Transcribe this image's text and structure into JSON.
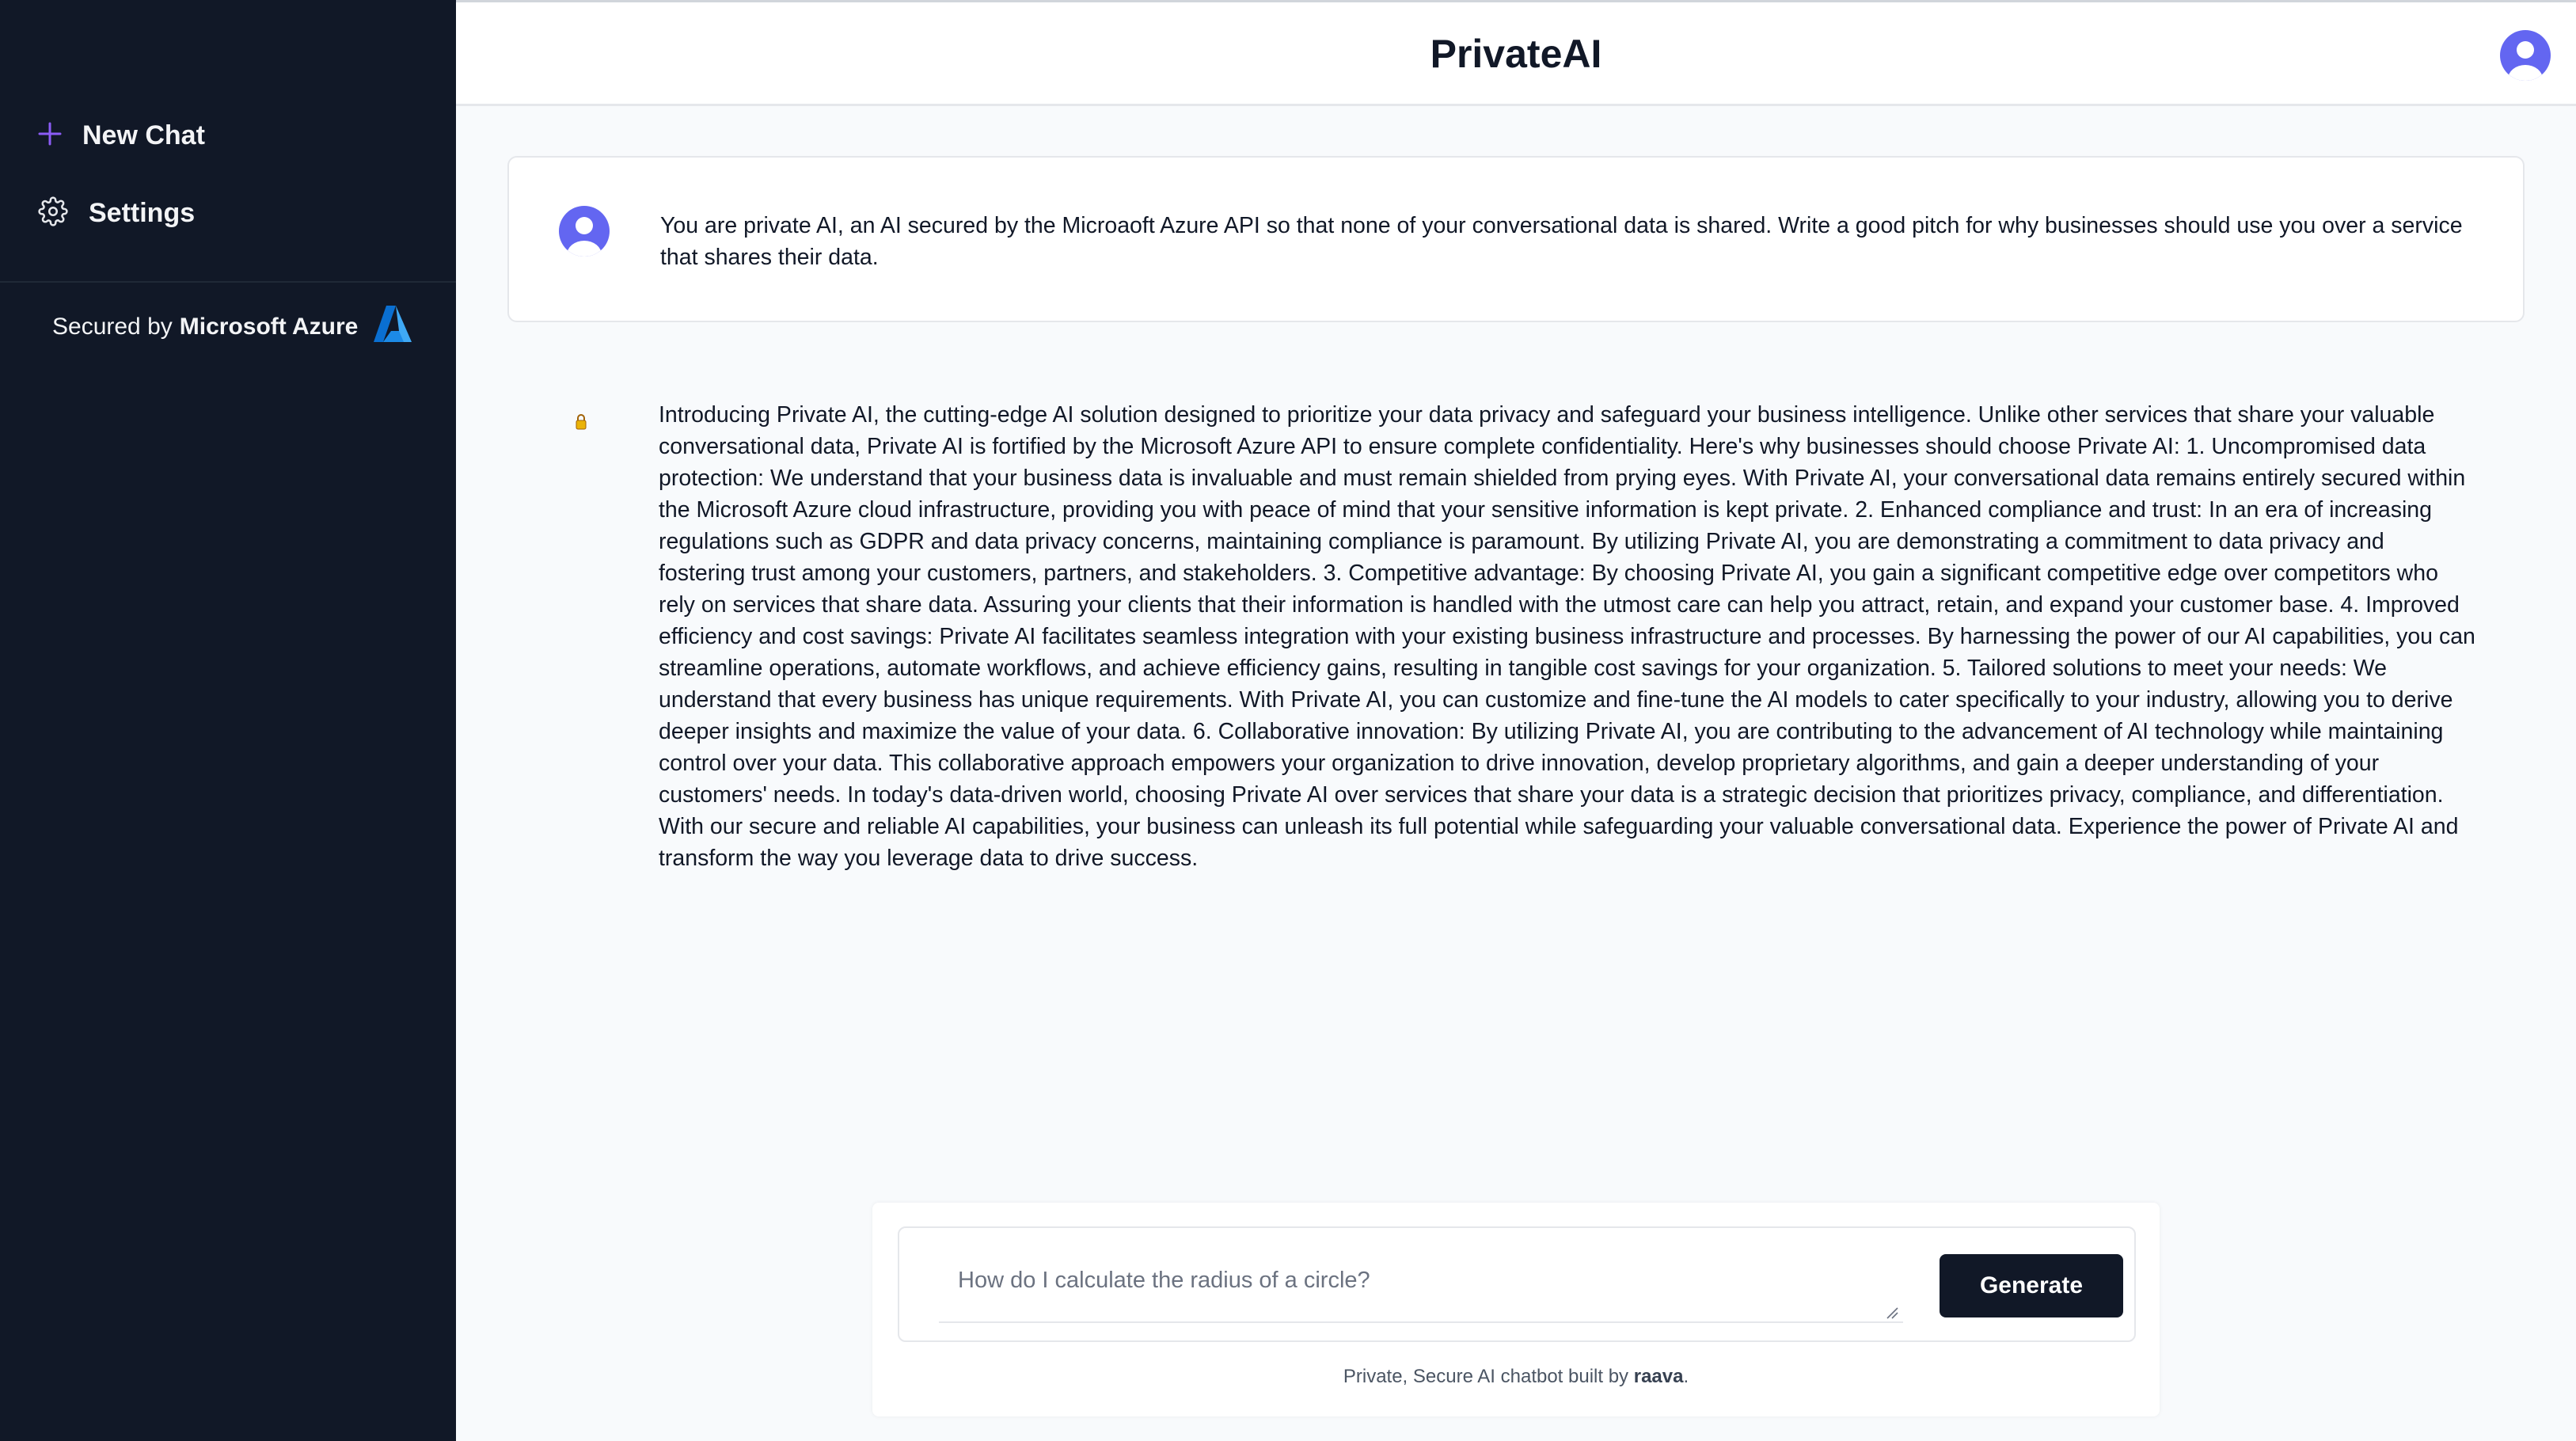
{
  "app": {
    "title": "PrivateAI"
  },
  "sidebar": {
    "items": [
      {
        "label": "New Chat",
        "icon": "plus-icon"
      },
      {
        "label": "Settings",
        "icon": "gear-icon"
      }
    ],
    "secured_prefix": "Secured by",
    "secured_brand": "Microsoft Azure",
    "secured_logo": "azure-logo"
  },
  "conversation": {
    "prompt": "You are private AI, an AI secured by the Microaoft Azure API so that none of your conversational data is shared. Write a good pitch for why businesses should use you over a service that shares their data.",
    "response": "Introducing Private AI, the cutting-edge AI solution designed to prioritize your data privacy and safeguard your business intelligence. Unlike other services that share your valuable conversational data, Private AI is fortified by the Microsoft Azure API to ensure complete confidentiality. Here's why businesses should choose Private AI: 1. Uncompromised data protection: We understand that your business data is invaluable and must remain shielded from prying eyes. With Private AI, your conversational data remains entirely secured within the Microsoft Azure cloud infrastructure, providing you with peace of mind that your sensitive information is kept private. 2. Enhanced compliance and trust: In an era of increasing regulations such as GDPR and data privacy concerns, maintaining compliance is paramount. By utilizing Private AI, you are demonstrating a commitment to data privacy and fostering trust among your customers, partners, and stakeholders. 3. Competitive advantage: By choosing Private AI, you gain a significant competitive edge over competitors who rely on services that share data. Assuring your clients that their information is handled with the utmost care can help you attract, retain, and expand your customer base. 4. Improved efficiency and cost savings: Private AI facilitates seamless integration with your existing business infrastructure and processes. By harnessing the power of our AI capabilities, you can streamline operations, automate workflows, and achieve efficiency gains, resulting in tangible cost savings for your organization. 5. Tailored solutions to meet your needs: We understand that every business has unique requirements. With Private AI, you can customize and fine-tune the AI models to cater specifically to your industry, allowing you to derive deeper insights and maximize the value of your data. 6. Collaborative innovation: By utilizing Private AI, you are contributing to the advancement of AI technology while maintaining control over your data. This collaborative approach empowers your organization to drive innovation, develop proprietary algorithms, and gain a deeper understanding of your customers' needs. In today's data-driven world, choosing Private AI over services that share your data is a strategic decision that prioritizes privacy, compliance, and differentiation. With our secure and reliable AI capabilities, your business can unleash its full potential while safeguarding your valuable conversational data. Experience the power of Private AI and transform the way you leverage data to drive success."
  },
  "composer": {
    "placeholder": "How do I calculate the radius of a circle?",
    "value": "",
    "button_label": "Generate"
  },
  "footer": {
    "prefix": "Private, Secure AI chatbot built by",
    "brand": "raava",
    "suffix": "."
  },
  "colors": {
    "sidebar_bg": "#111827",
    "accent": "#6366f1",
    "button_bg": "#111827",
    "page_bg": "#f8fafc"
  }
}
